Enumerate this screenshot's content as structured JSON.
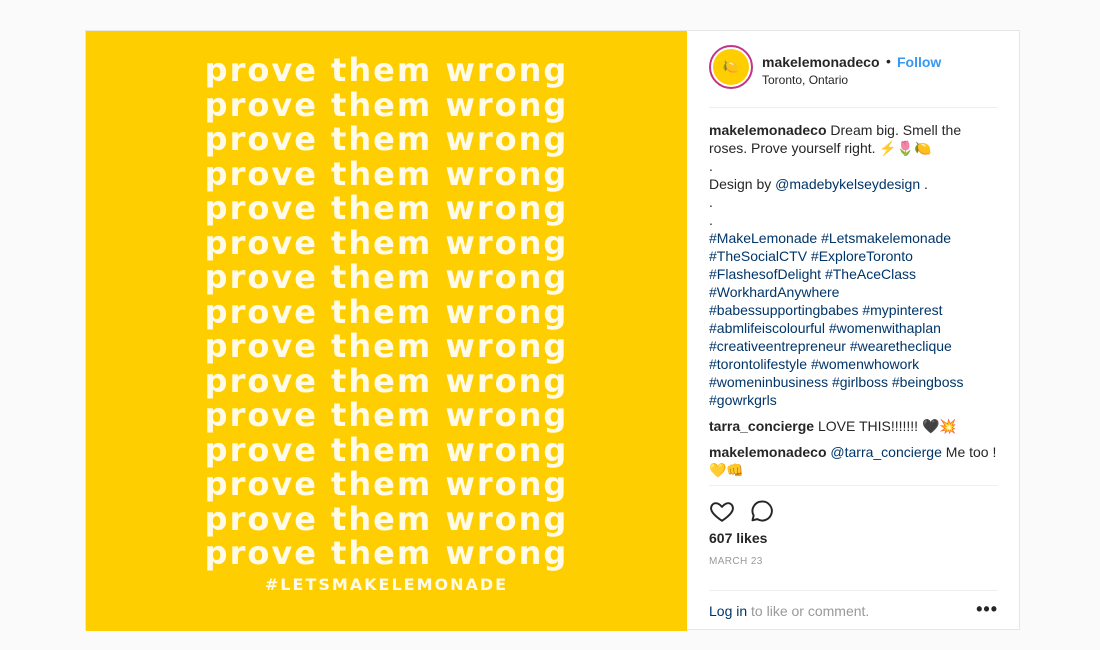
{
  "media": {
    "lines": [
      "prove them wrong",
      "prove them wrong",
      "prove them wrong",
      "prove them wrong",
      "prove them wrong",
      "prove them wrong",
      "prove them wrong",
      "prove them wrong",
      "prove them wrong",
      "prove them wrong",
      "prove them wrong",
      "prove them wrong",
      "prove them wrong",
      "prove them wrong",
      "prove them wrong"
    ],
    "tagline": "#LETSMAKELEMONADE",
    "background_color": "#ffce00"
  },
  "header": {
    "username": "makelemonadeco",
    "separator": "•",
    "follow_label": "Follow",
    "location": "Toronto, Ontario",
    "avatar_glyph": "🍋"
  },
  "caption": {
    "username": "makelemonadeco",
    "text": "Dream big. Smell the roses. Prove yourself right. ⚡️🌷🍋",
    "dot1": ".",
    "design_prefix": "Design by",
    "design_handle": "@madebykelseydesign",
    "design_suffix": ".",
    "dot2": ".",
    "dot3": ".",
    "hashtags": [
      "#MakeLemonade #Letsmakelemonade",
      "#TheSocialCTV #ExploreToronto",
      "#FlashesofDelight #TheAceClass",
      "#WorkhardAnywhere",
      "#babessupportingbabes #mypinterest",
      "#abmlifeiscolourful #womenwithaplan",
      "#creativeentrepreneur #wearetheclique",
      "#torontolifestyle #womenwhowork",
      "#womeninbusiness #girlboss #beingboss",
      "#gowrkgrls"
    ]
  },
  "comments": [
    {
      "username": "tarra_concierge",
      "text": "LOVE THIS!!!!!!! 🖤💥"
    },
    {
      "username": "makelemonadeco",
      "mention": "@tarra_concierge",
      "text": "Me too ! 💛👊"
    }
  ],
  "actions": {
    "like_icon": "heart-outline-icon",
    "comment_icon": "comment-bubble-icon",
    "likes": "607 likes",
    "date": "MARCH 23"
  },
  "footer": {
    "login_link": "Log in",
    "login_suffix": " to like or comment.",
    "more_glyph": "•••"
  }
}
